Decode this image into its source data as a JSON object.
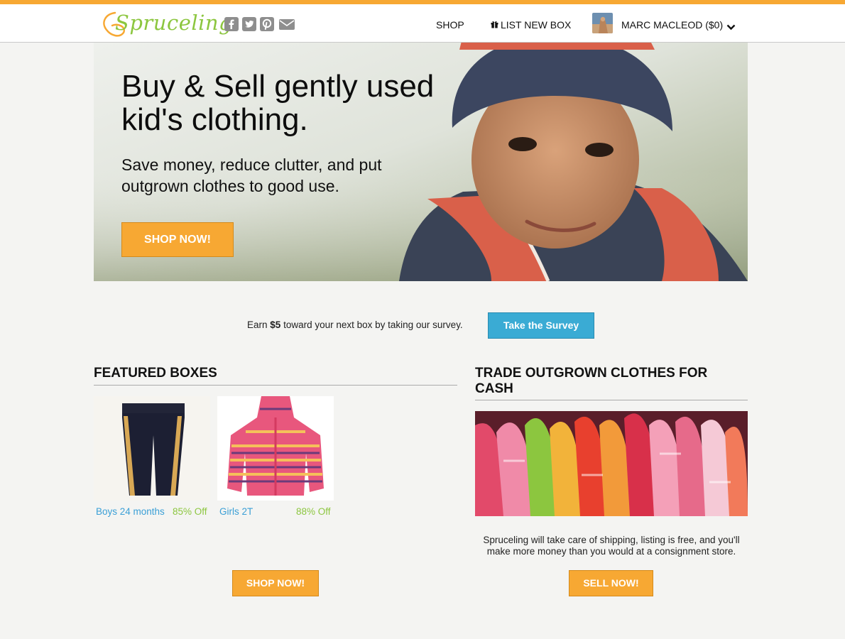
{
  "brand": {
    "name": "Spruceling",
    "accent": "#f7a833",
    "green": "#8cc63f",
    "blue": "#3aabd4"
  },
  "header": {
    "social_icons": [
      "facebook-icon",
      "twitter-icon",
      "pinterest-icon",
      "email-icon"
    ],
    "nav": {
      "shop": "SHOP",
      "list_new_box": "LIST NEW BOX",
      "user": "MARC MACLEOD ($0)"
    }
  },
  "hero": {
    "title": "Buy & Sell gently used kid's clothing.",
    "subtitle": "Save money, reduce clutter, and put outgrown clothes to good use.",
    "button": "SHOP NOW!"
  },
  "survey": {
    "text_before": "Earn ",
    "amount": "$5",
    "text_after": " toward your next box by taking our survey.",
    "button": "Take the Survey"
  },
  "featured": {
    "title": "FEATURED BOXES",
    "items": [
      {
        "label": "Boys 24 months",
        "discount": "85% Off"
      },
      {
        "label": "Girls 2T",
        "discount": "88% Off"
      }
    ],
    "button": "SHOP NOW!"
  },
  "trade": {
    "title_line1": "TRADE OUTGROWN CLOTHES FOR",
    "title_line2": "CASH",
    "description": "Spruceling will take care of shipping, listing is free, and you'll make more money than you would at a consignment store.",
    "button": "SELL NOW!"
  }
}
